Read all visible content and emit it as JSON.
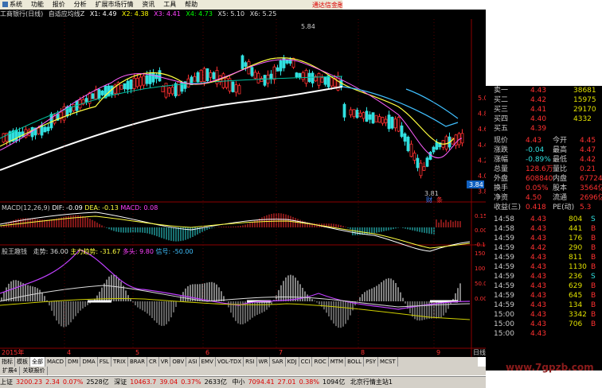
{
  "menu": [
    "系统",
    "功能",
    "报价",
    "分析",
    "扩展市场行情",
    "资讯",
    "工具",
    "帮助"
  ],
  "brand": "通达信金融终",
  "title": {
    "name": "工商银行(日线)",
    "indicator": "自适应均线Z",
    "ma": [
      "X1: 4.49",
      "X2: 4.38",
      "X3: 4.41",
      "X4: 4.73",
      "X5: 5.10",
      "X6: 5.25"
    ]
  },
  "price_axis": [
    "5.00",
    "4.80",
    "4.60",
    "4.40",
    "4.20",
    "4.00",
    "3.80"
  ],
  "price_marks": {
    "high": "5.84",
    "low": "3.81",
    "current": "3.84"
  },
  "markers": [
    "财",
    "条"
  ],
  "macd": {
    "label": "MACD(12,26,9)",
    "dif": "DIF: -0.09",
    "dea": "DEA: -0.13",
    "macd": "MACD: 0.08",
    "axis": [
      "0.15",
      "0.00",
      "-0.10"
    ]
  },
  "third": {
    "label": "股王趣钱",
    "trend": "走势: 36.00",
    "main": "主力趋势: -31.67",
    "long": "多头: 9.80",
    "signal": "信号: -50.00",
    "axis": [
      "150.00",
      "100.00",
      "50.00",
      "0.00"
    ]
  },
  "dates": [
    "2015年",
    "4",
    "5",
    "6",
    "7",
    "8",
    "9",
    "日线"
  ],
  "quote_rows": [
    {
      "label": "买一",
      "val": "4.43",
      "vol": "38681",
      "color": "#ff3030",
      "vcolor": "#e0e000"
    },
    {
      "label": "买二",
      "val": "4.42",
      "vol": "15975",
      "color": "#ff3030",
      "vcolor": "#e0e000"
    },
    {
      "label": "买三",
      "val": "4.40",
      "vol": "29170",
      "color": "#ff3030",
      "vcolor": "#e0e000"
    },
    {
      "label": "买四",
      "val": "4.39",
      "vol": "4332",
      "color": "#ff3030",
      "vcolor": "#e0e000"
    },
    {
      "label": "买五",
      "val": "",
      "vol": "",
      "color": "#ff3030",
      "vcolor": "#e0e000"
    }
  ],
  "top_quotes": [
    {
      "label": "卖一",
      "val": "4.43",
      "vol": "38681"
    },
    {
      "label": "买二",
      "val": "4.42",
      "vol": "15975"
    },
    {
      "label": "买三",
      "val": "4.41",
      "vol": "29170"
    },
    {
      "label": "买四",
      "val": "4.40",
      "vol": "4332"
    },
    {
      "label": "买五",
      "val": "4.39",
      "vol": ""
    }
  ],
  "stats": [
    {
      "l1": "现价",
      "v1": "4.43",
      "l2": "今开",
      "v2": "4.45"
    },
    {
      "l1": "涨跌",
      "v1": "-0.04",
      "l2": "最高",
      "v2": "4.47"
    },
    {
      "l1": "涨幅",
      "v1": "-0.89%",
      "l2": "最低",
      "v2": "4.42"
    },
    {
      "l1": "总量",
      "v1": "128.6万",
      "l2": "量比",
      "v2": "0.21"
    },
    {
      "l1": "外盘",
      "v1": "608840",
      "l2": "内盘",
      "v2": "677244"
    },
    {
      "l1": "换手",
      "v1": "0.05%",
      "l2": "股本",
      "v2": "3564亿"
    },
    {
      "l1": "净资",
      "v1": "4.50",
      "l2": "流通",
      "v2": "2696亿"
    },
    {
      "l1": "收益(三)",
      "v1": "0.418",
      "l2": "PE(动)",
      "v2": "5.3"
    }
  ],
  "ticks": [
    {
      "t": "14:58",
      "p": "4.43",
      "v": "804",
      "s": "S"
    },
    {
      "t": "14:58",
      "p": "4.43",
      "v": "441",
      "s": "B"
    },
    {
      "t": "14:59",
      "p": "4.43",
      "v": "176",
      "s": "B"
    },
    {
      "t": "14:59",
      "p": "4.42",
      "v": "290",
      "s": "B"
    },
    {
      "t": "14:59",
      "p": "4.43",
      "v": "811",
      "s": "B"
    },
    {
      "t": "14:59",
      "p": "4.43",
      "v": "1130",
      "s": "B"
    },
    {
      "t": "14:59",
      "p": "4.43",
      "v": "236",
      "s": "S"
    },
    {
      "t": "14:59",
      "p": "4.43",
      "v": "629",
      "s": "B"
    },
    {
      "t": "14:59",
      "p": "4.43",
      "v": "645",
      "s": "B"
    },
    {
      "t": "14:59",
      "p": "4.43",
      "v": "134",
      "s": "B"
    },
    {
      "t": "15:00",
      "p": "4.43",
      "v": "3342",
      "s": "B"
    },
    {
      "t": "15:00",
      "p": "4.43",
      "v": "706",
      "s": "B"
    },
    {
      "t": "15:00",
      "p": "4.43",
      "v": "",
      "s": ""
    }
  ],
  "tabs": [
    "指标",
    "模板",
    "全部",
    "MACD",
    "DMI",
    "DMA",
    "FSL",
    "TRIX",
    "BRAR",
    "CR",
    "VR",
    "OBV",
    "ASI",
    "EMV",
    "VOL-TDX",
    "RSI",
    "WR",
    "SAR",
    "KDJ",
    "CCI",
    "ROC",
    "MTM",
    "BOLL",
    "PSY",
    "MCST"
  ],
  "tabs2": [
    "扩展4",
    "关联报价"
  ],
  "status": {
    "sh_label": "上证",
    "sh": "3200.23",
    "sh_chg": "2.34",
    "sh_pct": "0.07%",
    "sh_amt": "2528亿",
    "sz_label": "深证",
    "sz": "10463.7",
    "sz_chg": "39.04",
    "sz_pct": "0.37%",
    "sz_amt": "2633亿",
    "zx_label": "中小",
    "zx": "7094.41",
    "zx_chg": "27.01",
    "zx_pct": "0.38%",
    "zx_amt": "1094亿",
    "server": "北京行情主站1"
  },
  "watermark": "www.7gpzb.com"
}
